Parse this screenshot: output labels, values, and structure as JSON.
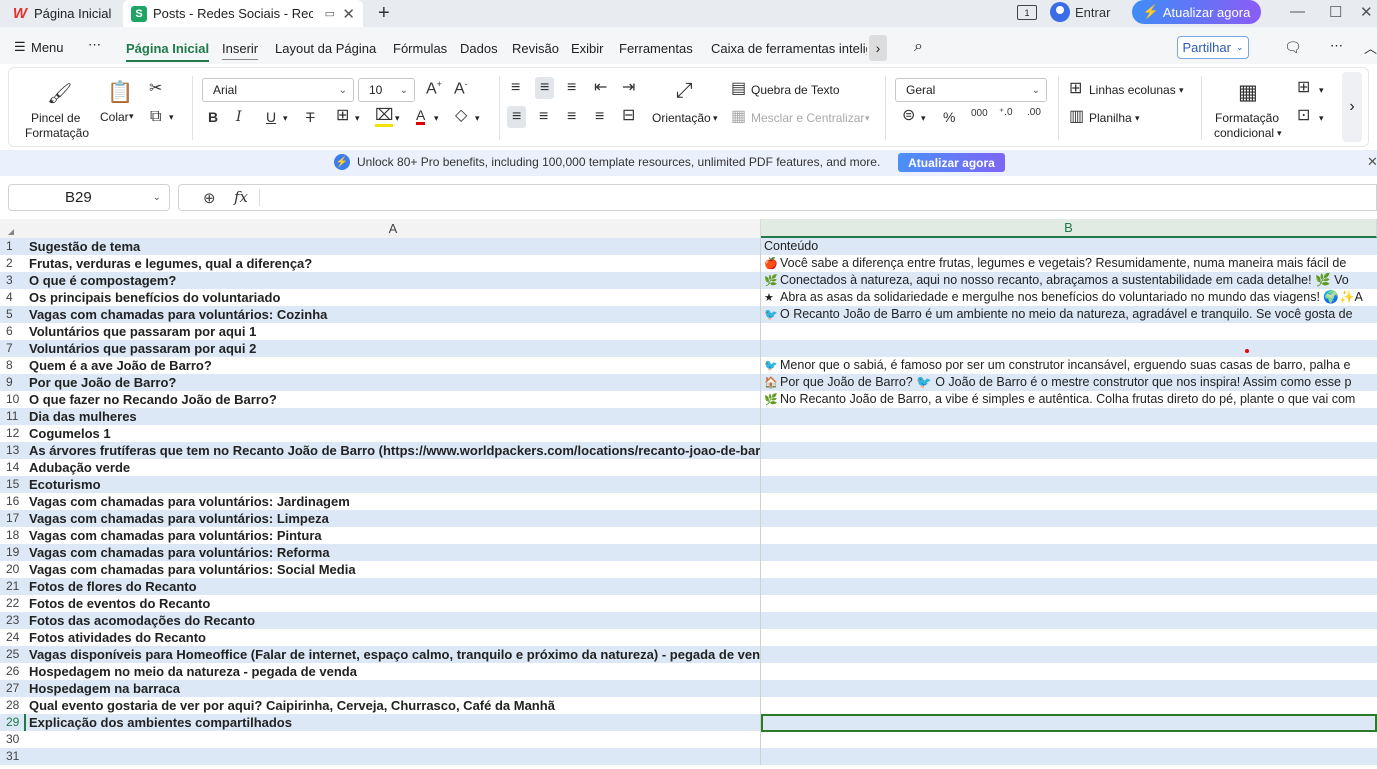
{
  "tabs": {
    "home": "Página Inicial",
    "doc": "Posts - Redes Sociais - Recanto João de Barro"
  },
  "account": {
    "login": "Entrar",
    "upgrade": "Atualizar agora"
  },
  "menu": {
    "menu_label": "Menu",
    "items": [
      "Página Inicial",
      "Inserir",
      "Layout da Página",
      "Fórmulas",
      "Dados",
      "Revisão",
      "Exibir",
      "Ferramentas",
      "Caixa de ferramentas inteligentes"
    ],
    "share": "Partilhar"
  },
  "toolbar": {
    "format_painter_1": "Pincel de",
    "format_painter_2": "Formatação",
    "paste": "Colar",
    "font": "Arial",
    "font_size": "10",
    "orientation": "Orientação",
    "wrap_text": "Quebra de Texto",
    "merge_center": "Mesclar e Centralizar",
    "number_format": "Geral",
    "rows_cols": "Linhas ecolunas",
    "sheet": "Planilha",
    "cond_format_1": "Formatação",
    "cond_format_2": "condicional"
  },
  "banner": {
    "text": "Unlock 80+ Pro benefits, including 100,000 template resources, unlimited PDF features, and more.",
    "button": "Atualizar agora"
  },
  "formula_bar": {
    "cell_ref": "B29",
    "fx": "fx",
    "content": ""
  },
  "columns": [
    "A",
    "B"
  ],
  "rows": [
    {
      "n": "1",
      "a": "Sugestão de tema",
      "b": "Conteúdo",
      "icon": ""
    },
    {
      "n": "2",
      "a": "Frutas, verduras e legumes, qual a diferença?",
      "b": "Você sabe a diferença entre frutas, legumes e vegetais? Resumidamente, numa maneira mais fácil de",
      "icon": "🍎"
    },
    {
      "n": "3",
      "a": "O que é compostagem?",
      "b": "Conectados à natureza, aqui no nosso recanto, abraçamos a sustentabilidade em cada detalhe! 🌿 Vo",
      "icon": "🌿"
    },
    {
      "n": "4",
      "a": "Os principais benefícios do voluntariado",
      "b": "Abra as asas da solidariedade e mergulhe nos benefícios do voluntariado no mundo das viagens! 🌍✨A",
      "icon": "★"
    },
    {
      "n": "5",
      "a": "Vagas com chamadas para voluntários: Cozinha",
      "b": "O Recanto João de Barro é um ambiente no meio da natureza, agradável e tranquilo. Se você gosta de",
      "icon": "🐦"
    },
    {
      "n": "6",
      "a": "Voluntários que passaram por aqui 1",
      "b": "",
      "icon": ""
    },
    {
      "n": "7",
      "a": "Voluntários que passaram por aqui 2",
      "b": "",
      "icon": ""
    },
    {
      "n": "8",
      "a": "Quem é a ave João de Barro?",
      "b": "Menor que o sabiá, é famoso por ser um construtor incansável, erguendo suas casas de barro, palha e",
      "icon": "🐦"
    },
    {
      "n": "9",
      "a": "Por que João de Barro?",
      "b": "Por que João de Barro? 🐦 O João de Barro é o mestre construtor que nos inspira! Assim como esse p",
      "icon": "🏠"
    },
    {
      "n": "10",
      "a": "O que fazer no Recando João de Barro?",
      "b": "No Recanto João de Barro, a vibe é simples e autêntica. Colha frutas direto do pé, plante o que vai com",
      "icon": "🌿"
    },
    {
      "n": "11",
      "a": "Dia das mulheres",
      "b": "",
      "icon": ""
    },
    {
      "n": "12",
      "a": "Cogumelos 1",
      "b": "",
      "icon": ""
    },
    {
      "n": "13",
      "a": "As árvores frutíferas que tem no Recanto João de Barro (https://www.worldpackers.com/locations/recanto-joao-de-barro-jardinopolis/)",
      "b": "",
      "icon": ""
    },
    {
      "n": "14",
      "a": "Adubação verde",
      "b": "",
      "icon": ""
    },
    {
      "n": "15",
      "a": "Ecoturismo",
      "b": "",
      "icon": ""
    },
    {
      "n": "16",
      "a": "Vagas com chamadas para voluntários: Jardinagem",
      "b": "",
      "icon": ""
    },
    {
      "n": "17",
      "a": "Vagas com chamadas para voluntários: Limpeza",
      "b": "",
      "icon": ""
    },
    {
      "n": "18",
      "a": "Vagas com chamadas para voluntários: Pintura",
      "b": "",
      "icon": ""
    },
    {
      "n": "19",
      "a": "Vagas com chamadas para voluntários: Reforma",
      "b": "",
      "icon": ""
    },
    {
      "n": "20",
      "a": "Vagas com chamadas para voluntários: Social Media",
      "b": "",
      "icon": ""
    },
    {
      "n": "21",
      "a": "Fotos de flores do Recanto",
      "b": "",
      "icon": ""
    },
    {
      "n": "22",
      "a": "Fotos de eventos do Recanto",
      "b": "",
      "icon": ""
    },
    {
      "n": "23",
      "a": "Fotos das acomodações do Recanto",
      "b": "",
      "icon": ""
    },
    {
      "n": "24",
      "a": "Fotos atividades do Recanto",
      "b": "",
      "icon": ""
    },
    {
      "n": "25",
      "a": "Vagas disponíveis para Homeoffice (Falar de internet, espaço calmo, tranquilo e próximo da natureza) - pegada de venda",
      "b": "",
      "icon": ""
    },
    {
      "n": "26",
      "a": "Hospedagem no meio da natureza - pegada de venda",
      "b": "",
      "icon": ""
    },
    {
      "n": "27",
      "a": "Hospedagem na barraca",
      "b": "",
      "icon": ""
    },
    {
      "n": "28",
      "a": "Qual evento gostaria de ver por aqui? Caipirinha, Cerveja, Churrasco, Café da Manhã",
      "b": "",
      "icon": ""
    },
    {
      "n": "29",
      "a": "Explicação dos ambientes compartilhados",
      "b": "",
      "icon": ""
    },
    {
      "n": "30",
      "a": "",
      "b": "",
      "icon": ""
    },
    {
      "n": "31",
      "a": "",
      "b": "",
      "icon": ""
    }
  ],
  "selected_row": "29",
  "colors": {
    "accent": "#1e7a4a",
    "band": "#dde8f7",
    "upgrade": "#6a6ff5"
  }
}
